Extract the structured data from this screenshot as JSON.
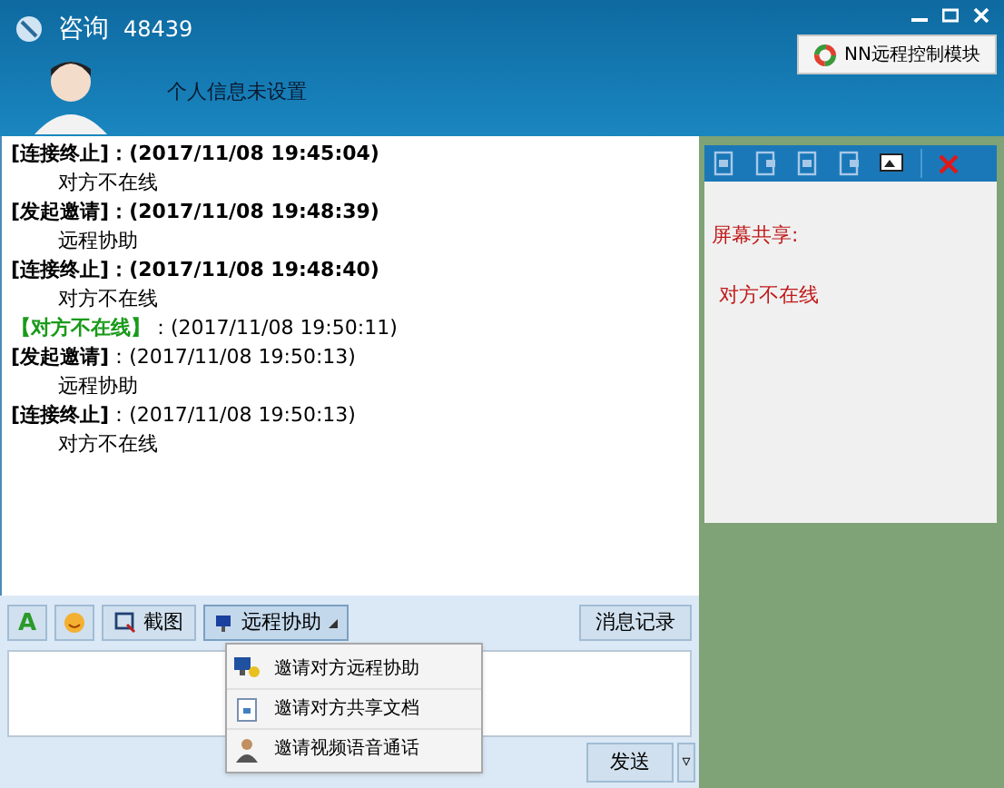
{
  "window": {
    "title": "咨询",
    "id_number": "48439"
  },
  "profile": {
    "status_text": "个人信息未设置"
  },
  "module_button": {
    "label": "NN远程控制模块"
  },
  "messages": [
    {
      "kind": "event",
      "label": "[连接终止]",
      "time": "：(2017/11/08 19:45:04)",
      "time_bold": true,
      "body": "对方不在线"
    },
    {
      "kind": "event",
      "label": "[发起邀请]",
      "time": "：(2017/11/08 19:48:39)",
      "time_bold": true,
      "body": "远程协助"
    },
    {
      "kind": "event",
      "label": "[连接终止]",
      "time": "：(2017/11/08 19:48:40)",
      "time_bold": true,
      "body": "对方不在线"
    },
    {
      "kind": "status",
      "label": "【对方不在线】",
      "time": "：(2017/11/08 19:50:11)",
      "time_bold": false
    },
    {
      "kind": "event",
      "label": "[发起邀请]",
      "time": "：(2017/11/08 19:50:13)",
      "time_bold": false,
      "body": "远程协助"
    },
    {
      "kind": "event",
      "label": "[连接终止]",
      "time": "：(2017/11/08 19:50:13)",
      "time_bold": false,
      "body": "对方不在线"
    }
  ],
  "toolbar": {
    "screenshot": "截图",
    "remote_assist": "远程协助",
    "history": "消息记录",
    "font_icon": "A"
  },
  "menu": [
    {
      "kind": "remote",
      "label": "邀请对方远程协助"
    },
    {
      "kind": "document",
      "label": "邀请对方共享文档"
    },
    {
      "kind": "video",
      "label": "邀请视频语音通话"
    }
  ],
  "send_button": {
    "label": "发送",
    "arrow": "▿"
  },
  "side_panel": {
    "title": "屏幕共享:",
    "message": "对方不在线"
  }
}
